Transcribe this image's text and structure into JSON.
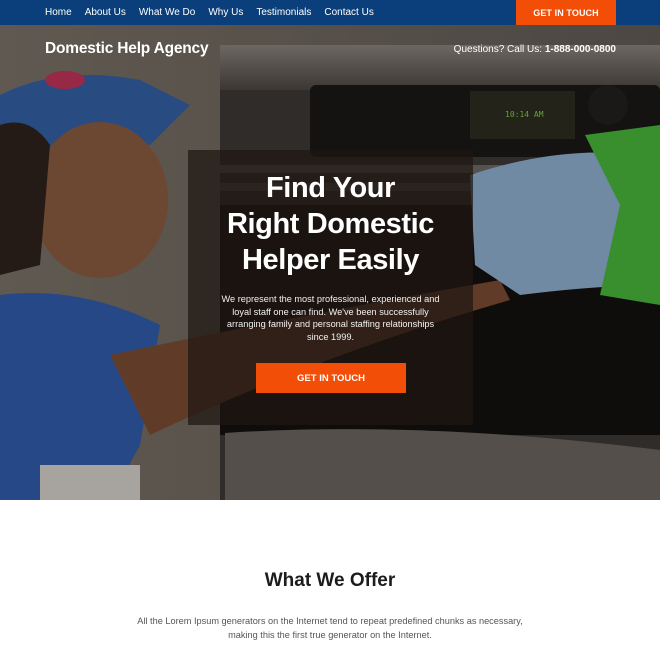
{
  "nav": {
    "links": [
      "Home",
      "About Us",
      "What We Do",
      "Why Us",
      "Testimonials",
      "Contact Us"
    ],
    "cta_label": "GET IN TOUCH"
  },
  "header": {
    "brand": "Domestic Help Agency",
    "phone_prefix": "Questions? Call Us:",
    "phone_number": "1-888-000-0800"
  },
  "hero": {
    "title_lines": [
      "Find Your",
      "Right Domestic",
      "Helper Easily"
    ],
    "description": "We represent the most professional, experienced and loyal staff one can find. We've been successfully arranging family and personal staffing relationships since 1999.",
    "cta_label": "GET IN TOUCH",
    "oven_display": "10:14 AM"
  },
  "offer": {
    "title": "What We Offer",
    "text": "All the Lorem Ipsum generators on the Internet tend to repeat predefined chunks as necessary, making this the first true generator on the Internet."
  },
  "colors": {
    "nav_bg": "#0a3f7b",
    "accent": "#f24e07",
    "heading": "#1c1c1c"
  }
}
